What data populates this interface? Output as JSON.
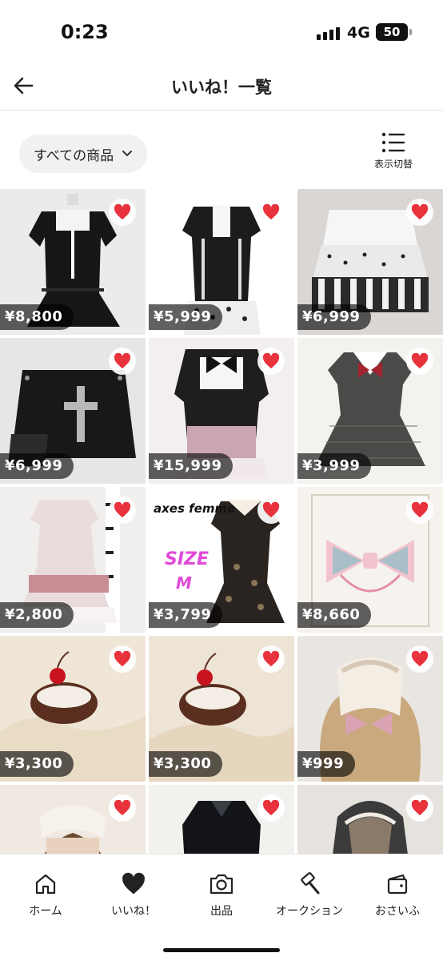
{
  "status": {
    "time": "0:23",
    "network": "4G",
    "battery": "50"
  },
  "header": {
    "title": "いいね！一覧"
  },
  "filter": {
    "label": "すべての商品",
    "view_toggle_label": "表示切替"
  },
  "items": [
    {
      "price": "¥8,800"
    },
    {
      "price": "¥5,999"
    },
    {
      "price": "¥6,999"
    },
    {
      "price": "¥6,999"
    },
    {
      "price": "¥15,999"
    },
    {
      "price": "¥3,999"
    },
    {
      "price": "¥2,800"
    },
    {
      "price": "¥3,799",
      "overlay": {
        "brand": "axes femme",
        "size_label": "SIZE",
        "size_value": "M"
      }
    },
    {
      "price": "¥8,660"
    },
    {
      "price": "¥3,300"
    },
    {
      "price": "¥3,300"
    },
    {
      "price": "¥999"
    },
    {
      "price": ""
    },
    {
      "price": ""
    },
    {
      "price": ""
    }
  ],
  "nav": [
    {
      "label": "ホーム",
      "icon": "home-icon"
    },
    {
      "label": "いいね！",
      "icon": "heart-icon"
    },
    {
      "label": "出品",
      "icon": "camera-icon"
    },
    {
      "label": "オークション",
      "icon": "auction-hammer-icon"
    },
    {
      "label": "おさいふ",
      "icon": "wallet-icon"
    }
  ],
  "colors": {
    "like": "#e8323c",
    "price_bg": "#000000",
    "filter_bg": "#f1f1f1"
  }
}
